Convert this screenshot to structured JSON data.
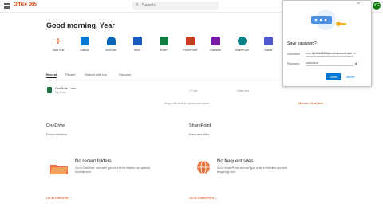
{
  "header": {
    "brand": "Office 365",
    "search_placeholder": "Search",
    "user_initials": "YG"
  },
  "greeting": "Good morning, Year",
  "apps": [
    {
      "label": "Start new",
      "color": "#d83b01",
      "icon": "plus-icon"
    },
    {
      "label": "Outlook",
      "color": "#0078d4",
      "icon": "outlook-icon"
    },
    {
      "label": "OneDrive",
      "color": "#0364b8",
      "icon": "onedrive-icon"
    },
    {
      "label": "Word",
      "color": "#185abd",
      "icon": "word-icon"
    },
    {
      "label": "Excel",
      "color": "#107c41",
      "icon": "excel-icon"
    },
    {
      "label": "PowerPoint",
      "color": "#c43e1c",
      "icon": "powerpoint-icon"
    },
    {
      "label": "OneNote",
      "color": "#7719aa",
      "icon": "onenote-icon"
    },
    {
      "label": "SharePoint",
      "color": "#038387",
      "icon": "sharepoint-icon"
    },
    {
      "label": "Teams",
      "color": "#5059c9",
      "icon": "teams-icon"
    }
  ],
  "tabs": [
    "Recent",
    "Pinned",
    "Shared with me",
    "Discover"
  ],
  "recent_file": {
    "name": "OneNote Form",
    "location": "My Drive",
    "date": "17 min",
    "owner": "Ownr-suo"
  },
  "drag_note": "Drag a file here to upload and share",
  "more_onedrive": "More in OneDrive →",
  "onedrive": {
    "title": "OneDrive",
    "subtitle": "Recent folders",
    "empty_title": "No recent folders",
    "empty_desc": "Go to OneDrive, and we'll put a list of the folders you opened recently here",
    "link": "Go to OneDrive →"
  },
  "sharepoint": {
    "title": "SharePoint",
    "subtitle": "Frequent sites",
    "empty_title": "No frequent sites",
    "empty_desc": "Go to SharePoint, and we'll put a list of the sites you visit frequently here",
    "link": "Go to SharePoint →"
  },
  "password_popup": {
    "question": "Save password?",
    "username_label": "Username",
    "username_value": "year.f@office365tips.onmicrosoft.com",
    "password_label": "Password",
    "password_value": "•••••••••••••",
    "save": "Save",
    "never": "Never",
    "close": "×"
  }
}
